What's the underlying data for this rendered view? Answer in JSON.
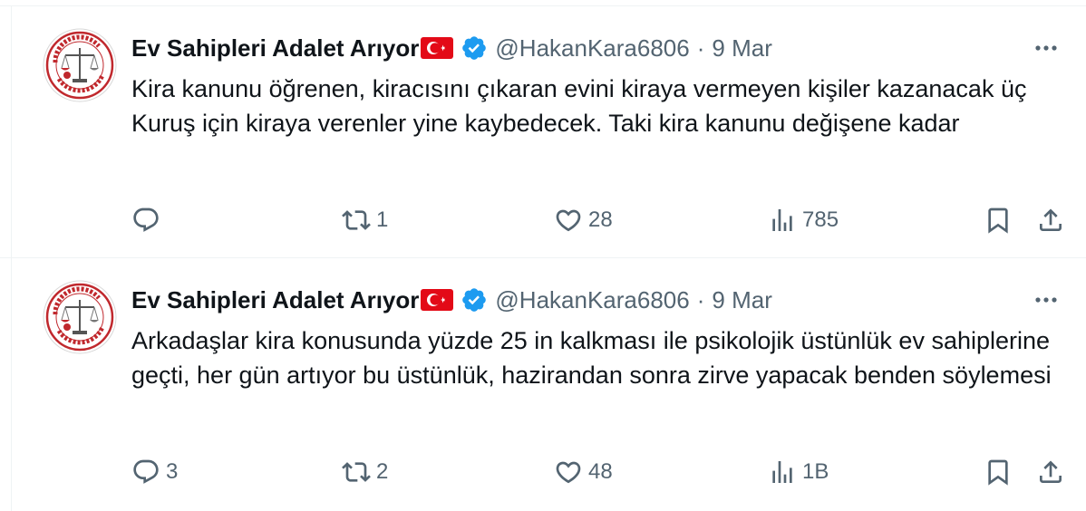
{
  "tweets": [
    {
      "author_name": "Ev Sahipleri Adalet Arıyor",
      "handle": "@HakanKara6806",
      "separator": "·",
      "date": "9 Mar",
      "text": "Kira kanunu öğrenen, kiracısını çıkaran evini kiraya vermeyen kişiler kazanacak üç Kuruş için kiraya verenler yine kaybedecek. Taki kira kanunu değişene kadar",
      "replies": "",
      "reposts": "1",
      "likes": "28",
      "views": "785"
    },
    {
      "author_name": "Ev Sahipleri Adalet Arıyor",
      "handle": "@HakanKara6806",
      "separator": "·",
      "date": "9 Mar",
      "text": "Arkadaşlar kira konusunda yüzde 25 in kalkması ile psikolojik üstünlük ev sahiplerine geçti, her gün artıyor bu üstünlük, hazirandan sonra zirve yapacak benden söylemesi",
      "replies": "3",
      "reposts": "2",
      "likes": "48",
      "views": "1B"
    }
  ],
  "avatar_logo_text": "EV SAHİPLERİ ADALET ARIYOR",
  "icons": {
    "flag": "turkey-flag-icon",
    "verified": "verified-badge-icon",
    "more": "more-options-icon",
    "reply": "reply-icon",
    "repost": "repost-icon",
    "like": "heart-icon",
    "views": "views-chart-icon",
    "bookmark": "bookmark-icon",
    "share": "share-icon"
  },
  "colors": {
    "text_primary": "#0f1419",
    "text_secondary": "#536471",
    "verified_blue": "#1d9bf0",
    "flag_red": "#e30a17",
    "logo_red": "#c0282d"
  }
}
